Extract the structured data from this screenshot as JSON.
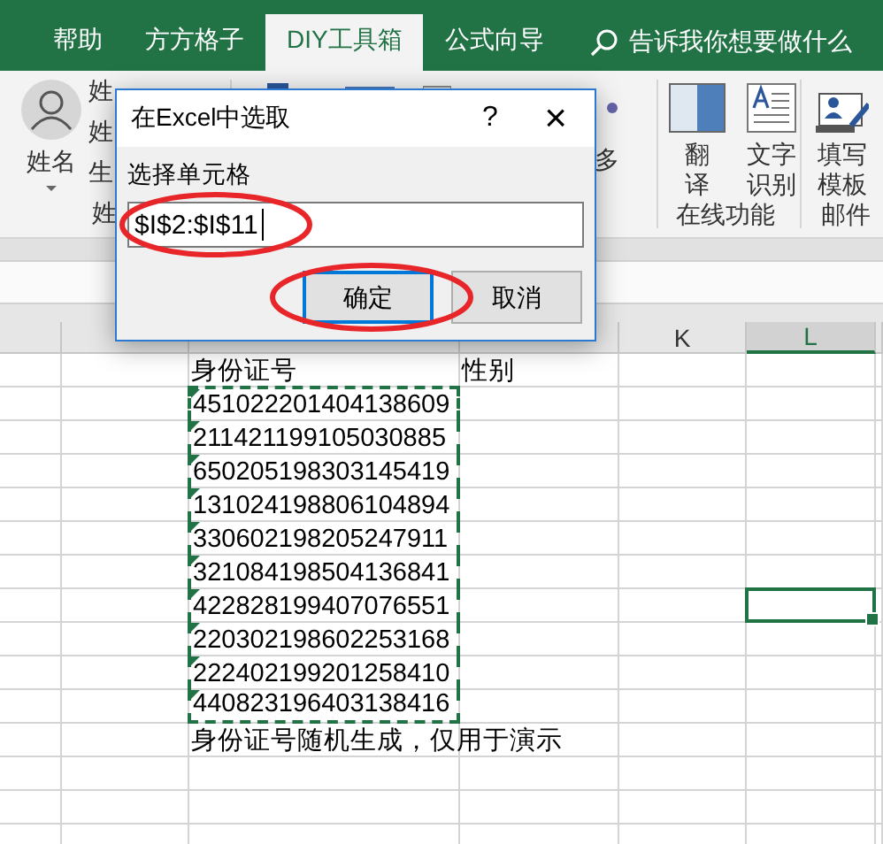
{
  "ribbon_tabs": [
    {
      "label": "帮助",
      "selected": false
    },
    {
      "label": "方方格子",
      "selected": false
    },
    {
      "label": "DIY工具箱",
      "selected": true
    },
    {
      "label": "公式向导",
      "selected": false
    }
  ],
  "tell_me": "告诉我你想要做什么",
  "ribbon": {
    "name_button": "姓名",
    "partial_items": [
      "姓",
      "姓",
      "生"
    ],
    "partial_group_label": "姓",
    "partial_button": "多",
    "buttons": [
      {
        "lines": [
          "翻",
          "译"
        ]
      },
      {
        "lines": [
          "文字",
          "识别"
        ]
      },
      {
        "lines": [
          "填写",
          "模板"
        ]
      }
    ],
    "groups": [
      "在线功能",
      "邮件"
    ]
  },
  "sheet": {
    "columns": [
      {
        "selected": false
      },
      {
        "selected": false
      },
      {
        "selected": false
      },
      {
        "selected": false
      },
      {
        "label": "K",
        "selected": false
      },
      {
        "label": "L",
        "selected": true
      }
    ],
    "rows": [
      {
        "I": "身份证号",
        "J": "性别",
        "selected": false
      },
      {
        "I": "451022201404138609",
        "flag": true,
        "marquee": true,
        "selected": false
      },
      {
        "I": "211421199105030885",
        "flag": true,
        "marquee": true,
        "selected": false
      },
      {
        "I": "650205198303145419",
        "flag": true,
        "marquee": true,
        "selected": false
      },
      {
        "I": "131024198806104894",
        "flag": true,
        "marquee": true,
        "selected": false
      },
      {
        "I": "330602198205247911",
        "flag": true,
        "marquee": true,
        "selected": false
      },
      {
        "I": "321084198504136841",
        "flag": true,
        "marquee": true,
        "selected": false
      },
      {
        "I": "422828199407076551",
        "flag": true,
        "marquee": true,
        "selected": true
      },
      {
        "I": "220302198602253168",
        "flag": true,
        "marquee": true,
        "selected": false
      },
      {
        "I": "222402199201258410",
        "flag": true,
        "marquee": true,
        "selected": false
      },
      {
        "I": "440823196403138416",
        "flag": true,
        "marquee": true,
        "selected": false
      },
      {
        "I": "身份证号随机生成，仅用于演示",
        "selected": false
      }
    ]
  },
  "dialog": {
    "title": "在Excel中选取",
    "help": "?",
    "close": "×",
    "label": "选择单元格",
    "value": "$I$2:$I$11",
    "buttons": [
      {
        "label": "确定",
        "focused": true
      },
      {
        "label": "取消",
        "focused": false
      }
    ]
  },
  "annotations": [
    {
      "kind": "ellipse"
    },
    {
      "kind": "ellipse"
    }
  ]
}
